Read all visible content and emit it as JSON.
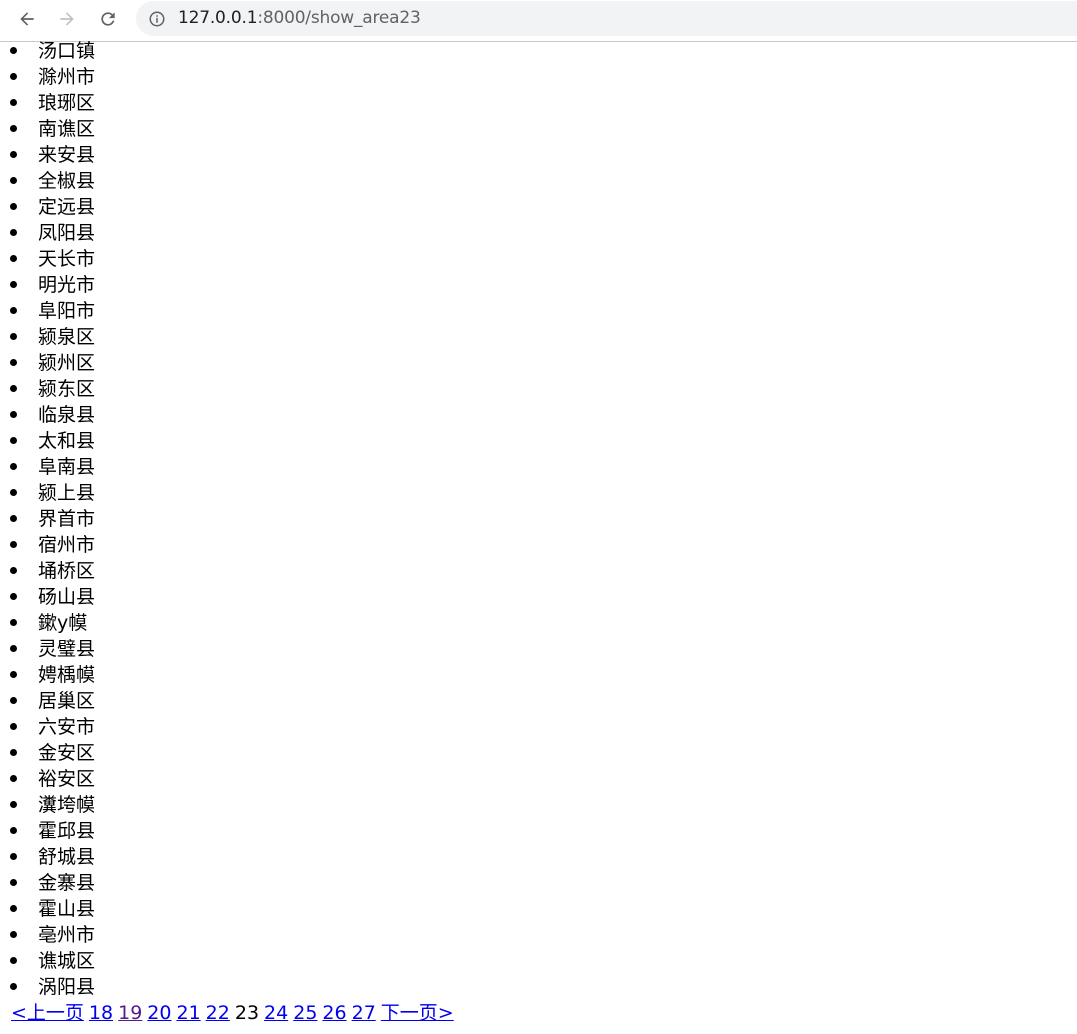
{
  "browser": {
    "url_host": "127.0.0.1",
    "url_rest": ":8000/show_area23",
    "icons": {
      "back": "back-arrow-icon",
      "forward": "forward-arrow-icon",
      "reload": "reload-icon",
      "info": "info-icon"
    }
  },
  "areas": [
    "汤口镇",
    "滁州市",
    "琅琊区",
    "南谯区",
    "来安县",
    "全椒县",
    "定远县",
    "凤阳县",
    "天长市",
    "明光市",
    "阜阳市",
    "颍泉区",
    "颍州区",
    "颍东区",
    "临泉县",
    "太和县",
    "阜南县",
    "颍上县",
    "界首市",
    "宿州市",
    "埇桥区",
    "砀山县",
    "鏉у幙",
    "灵璧县",
    "娉楀幙",
    "居巢区",
    "六安市",
    "金安区",
    "裕安区",
    "瀵垮幙",
    "霍邱县",
    "舒城县",
    "金寨县",
    "霍山县",
    "亳州市",
    "谯城区",
    "涡阳县"
  ],
  "pagination": {
    "prev_label": "<上一页",
    "next_label": "下一页>",
    "pages": [
      "18",
      "19",
      "20",
      "21",
      "22",
      "23",
      "24",
      "25",
      "26",
      "27"
    ],
    "current": "23",
    "visited": [
      "19"
    ]
  },
  "colors": {
    "link": "#0000ee",
    "visited_link": "#551a8b",
    "omnibox_bg": "#f1f3f4"
  }
}
